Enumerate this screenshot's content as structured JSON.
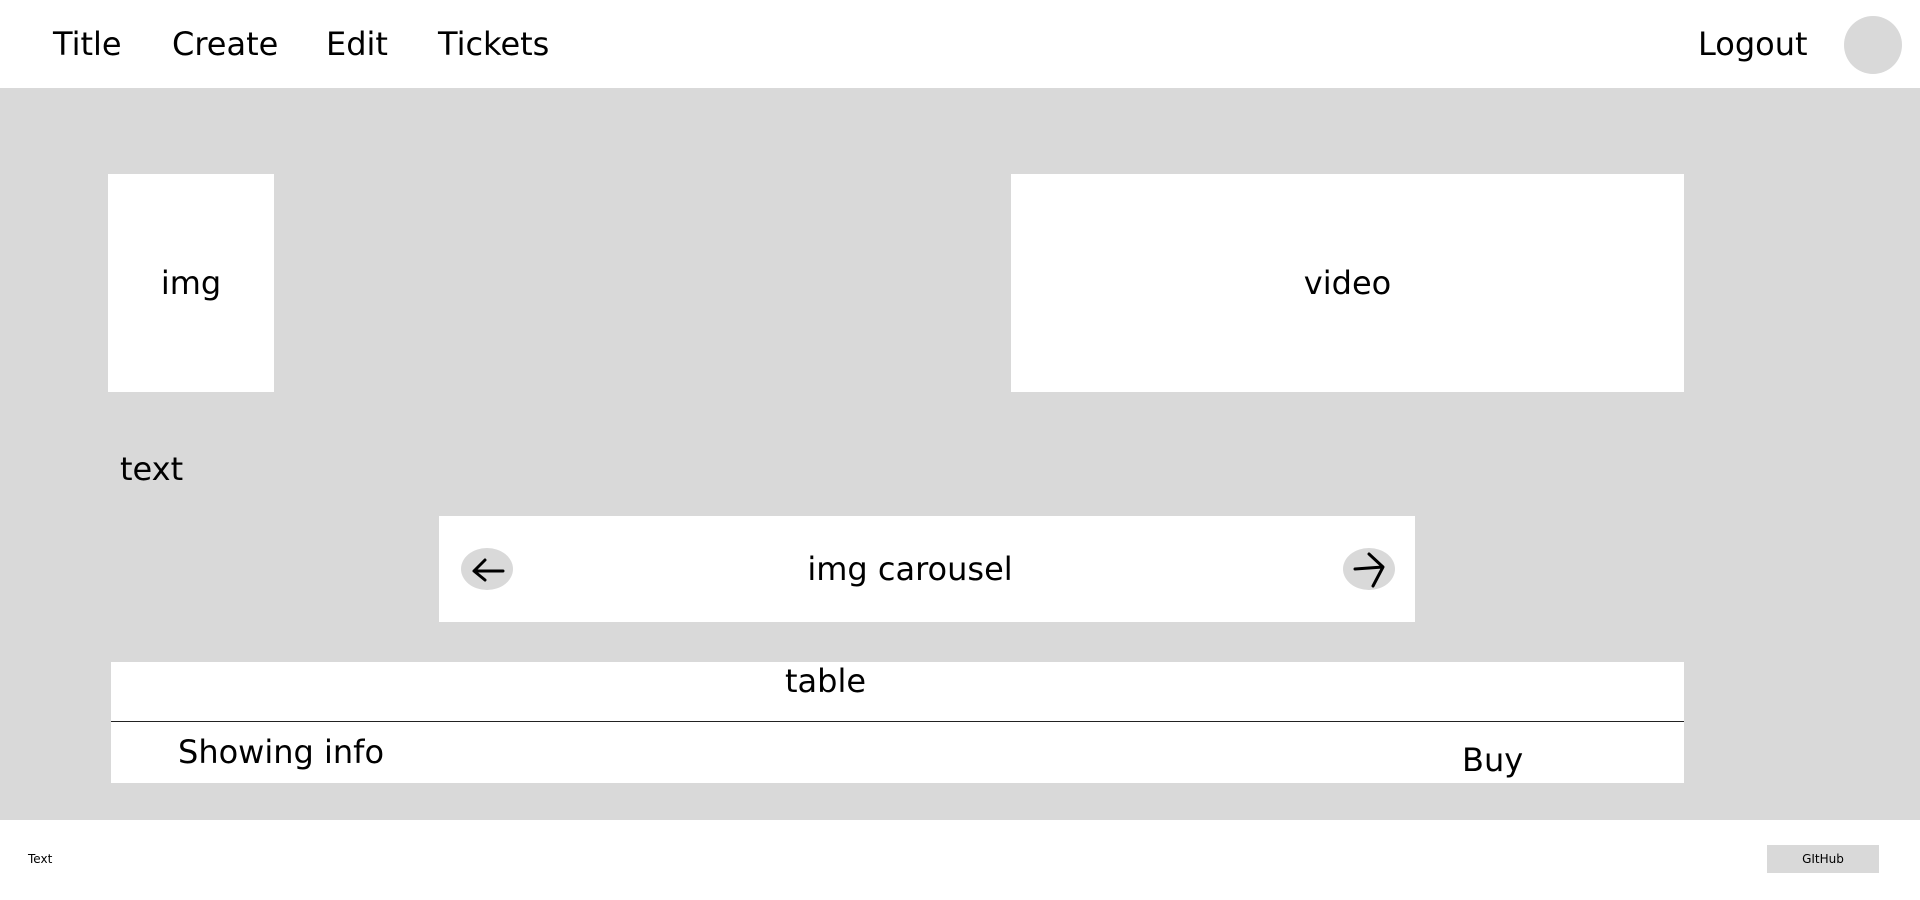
{
  "nav": {
    "title": "Title",
    "create": "Create",
    "edit": "Edit",
    "tickets": "Tickets",
    "logout": "Logout"
  },
  "main": {
    "img_label": "img",
    "video_label": "video",
    "text_label": "text",
    "carousel_label": "img carousel",
    "carousel_prev_icon": "arrow-left-icon",
    "carousel_next_icon": "arrow-right-icon"
  },
  "table": {
    "title": "table",
    "info": "Showing info",
    "buy_label": "Buy"
  },
  "footer": {
    "text": "Text",
    "github_label": "GItHub"
  },
  "colors": {
    "background": "#d9d9d9",
    "panel": "#ffffff",
    "text": "#000000"
  }
}
